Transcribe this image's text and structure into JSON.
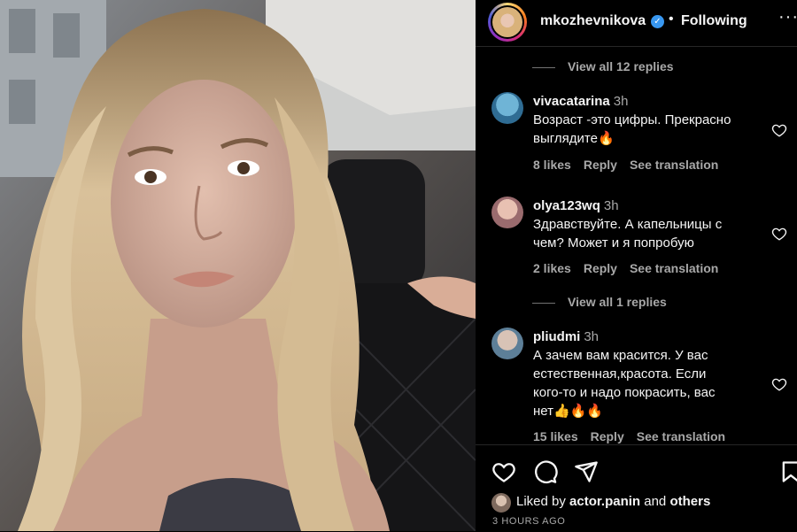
{
  "post": {
    "username": "mkozhevnikova",
    "follow_status": "Following",
    "separator": "•",
    "more_icon": "more-horizontal-icon",
    "verified_icon": "verified-check-icon"
  },
  "comments_section": {
    "view_replies_top": "View all 12 replies",
    "view_replies_mid": "View all 1 replies",
    "comments": [
      {
        "username": "vivacatarina",
        "time": "3h",
        "text": "Возраст -это цифры. Прекрасно\nвыглядите🔥",
        "likes": "8 likes",
        "reply": "Reply",
        "translation": "See translation"
      },
      {
        "username": "olya123wq",
        "time": "3h",
        "text": "Здравствуйте. А капельницы с\nчем? Может и я попробую",
        "likes": "2 likes",
        "reply": "Reply",
        "translation": "See translation"
      },
      {
        "username": "pliudmi",
        "time": "3h",
        "text": "А зачем вам красится. У вас\nестественная,красота. Если\nкого-то и надо покрасить, вас\nнет👍🔥🔥",
        "likes": "15 likes",
        "reply": "Reply",
        "translation": "See translation"
      }
    ]
  },
  "footer": {
    "liked_by_prefix": "Liked by",
    "liked_by_user": "actor.panin",
    "liked_by_and": "and",
    "liked_by_others": "others",
    "posted_ago": "3 HOURS AGO"
  },
  "colors": {
    "background": "#000000",
    "text_primary": "#f5f5f5",
    "text_secondary": "#a8a8a8",
    "verified": "#3897f0",
    "divider": "#262626"
  }
}
